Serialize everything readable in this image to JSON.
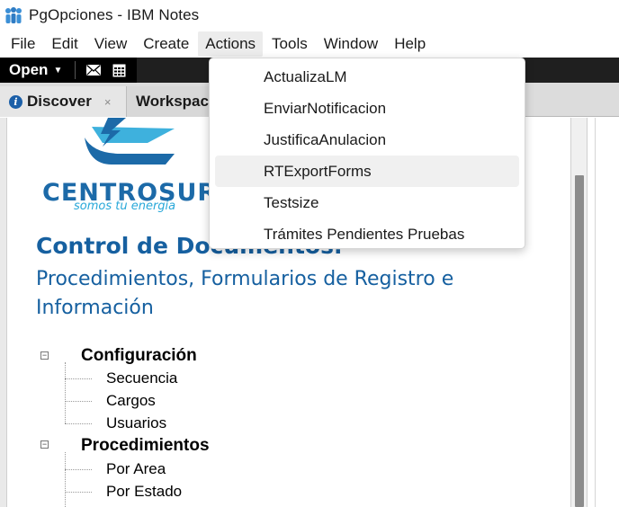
{
  "window": {
    "title": "PgOpciones - IBM Notes"
  },
  "menubar": {
    "items": [
      "File",
      "Edit",
      "View",
      "Create",
      "Actions",
      "Tools",
      "Window",
      "Help"
    ],
    "active_index": 4
  },
  "toolbar": {
    "open_label": "Open"
  },
  "tabs": [
    {
      "label": "Discover",
      "closable": true
    },
    {
      "label": "Workspace",
      "closable": false
    }
  ],
  "tab_close_symbol": "×",
  "document": {
    "logo_text": "CENTROSUR",
    "logo_tagline": "somos tu energía",
    "title": "Control de Documentos.",
    "subtitle": "Procedimientos, Formularios de Registro e Información",
    "tree": [
      {
        "section": "Configuración",
        "items": [
          "Secuencia",
          "Cargos",
          "Usuarios"
        ]
      },
      {
        "section": "Procedimientos",
        "items": [
          "Por Area",
          "Por Estado"
        ]
      }
    ]
  },
  "actions_menu": {
    "items": [
      "ActualizaLM",
      "EnviarNotificacion",
      "JustificaAnulacion",
      "RTExportForms",
      "Testsize",
      "Trámites Pendientes Pruebas"
    ],
    "hover_index": 3
  },
  "colors": {
    "brand_blue": "#1660a0",
    "logo_cyan": "#29a8d9",
    "toolbar_bg": "#000000"
  }
}
